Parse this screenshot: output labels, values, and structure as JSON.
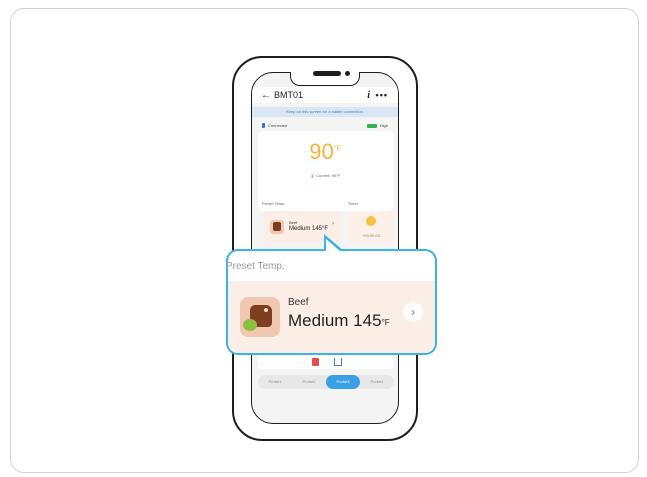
{
  "screen": {
    "nav": {
      "back_arrow": "←",
      "title": "BMT01",
      "info_label": "i",
      "more_label": "•••"
    },
    "banner": "Keep on this screen for a stable connection.",
    "status": {
      "connection": "Connected",
      "battery_label": "High"
    },
    "temperature": {
      "value": "90",
      "unit": "°F",
      "current": "Current: 90°F"
    },
    "labels": {
      "preset": "Preset Temp.",
      "timer": "Timer"
    },
    "mini_preset": {
      "food": "Beef",
      "doneness": "Medium 145°F"
    },
    "timer": {
      "value": "+00:00:00"
    },
    "tabs": [
      "Probe1",
      "Probe2",
      "Probe3",
      "Probe4"
    ],
    "active_tab": "Probe3"
  },
  "callout": {
    "heading": "Preset Temp.",
    "food": "Beef",
    "doneness": "Medium 145",
    "unit": "°F",
    "chevron": "›"
  },
  "colors": {
    "accent": "#3ab3e6",
    "temp": "#f2b43b",
    "card": "#fbeee6"
  }
}
